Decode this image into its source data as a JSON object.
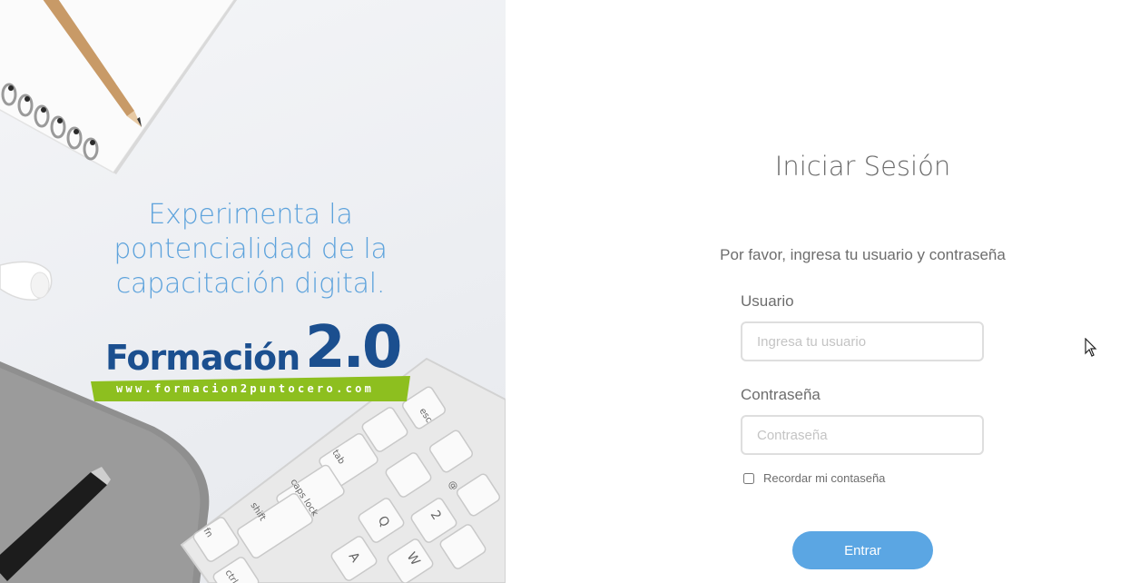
{
  "hero": {
    "tagline_lines": [
      "Experimenta la",
      "pontencialidad de la",
      "capacitación digital."
    ],
    "logo": {
      "word": "Formación",
      "number": "2.0",
      "url": "www.formacion2puntocero.com"
    },
    "keyboard_keys": [
      "esc",
      "tab",
      "caps lock",
      "shift",
      "fn",
      "Q",
      "A",
      "W",
      "2",
      "@",
      "ctrl"
    ]
  },
  "login": {
    "title": "Iniciar Sesión",
    "instructions": "Por favor, ingresa tu usuario y contraseña",
    "username": {
      "label": "Usuario",
      "placeholder": "Ingresa tu usuario",
      "value": ""
    },
    "password": {
      "label": "Contraseña",
      "placeholder": "Contraseña",
      "value": ""
    },
    "remember": {
      "label": "Recordar mi contaseña",
      "checked": false
    },
    "submit_label": "Entrar"
  },
  "colors": {
    "accent": "#5ba6e3",
    "tagline": "#5ea3dc",
    "logo_blue": "#1b4f8f",
    "logo_green": "#8dbf1f"
  }
}
